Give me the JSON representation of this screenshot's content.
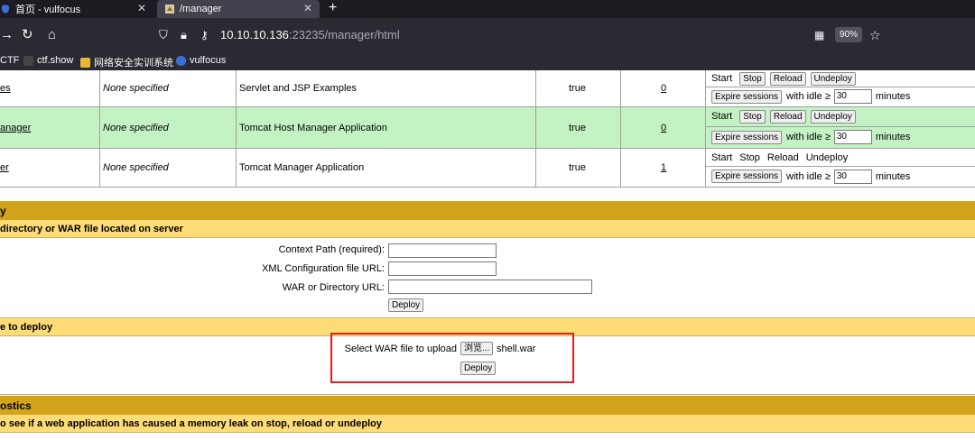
{
  "browser": {
    "tabs": [
      {
        "label": "首页 - vulfocus"
      },
      {
        "label": "/manager"
      }
    ],
    "url_host": "10.10.10.136",
    "url_rest": ":23235/manager/html",
    "zoom": "90%",
    "bookmarks": [
      {
        "label": "CTF"
      },
      {
        "label": "ctf.show"
      },
      {
        "label": "网络安全实训系统"
      },
      {
        "label": "vulfocus"
      }
    ]
  },
  "applications": [
    {
      "path": "es",
      "version": "None specified",
      "display_name": "Servlet and JSP Examples",
      "running": "true",
      "sessions": "0",
      "cmd_style": "buttons",
      "idle": "30",
      "green": false
    },
    {
      "path": "anager",
      "version": "None specified",
      "display_name": "Tomcat Host Manager Application",
      "running": "true",
      "sessions": "0",
      "cmd_style": "buttons",
      "idle": "30",
      "green": true
    },
    {
      "path": "er",
      "version": "None specified",
      "display_name": "Tomcat Manager Application",
      "running": "true",
      "sessions": "1",
      "cmd_style": "plain",
      "idle": "30",
      "green": false
    }
  ],
  "commands": {
    "start": "Start",
    "stop": "Stop",
    "reload": "Reload",
    "undeploy": "Undeploy",
    "expire": "Expire sessions",
    "with_idle": "with idle ≥",
    "minutes": "minutes"
  },
  "deploy": {
    "title": "y",
    "server_section": "directory or WAR file located on server",
    "context_path_label": "Context Path (required):",
    "xml_config_label": "XML Configuration file URL:",
    "war_dir_label": "WAR or Directory URL:",
    "deploy_button": "Deploy",
    "upload_section": "e to deploy",
    "select_war_label": "Select WAR file to upload",
    "browse_button": "浏览...",
    "selected_file": "shell.war",
    "upload_deploy_button": "Deploy"
  },
  "diagnostics": {
    "title": "ostics",
    "leak_section": "o see if a web application has caused a memory leak on stop, reload or undeploy"
  }
}
